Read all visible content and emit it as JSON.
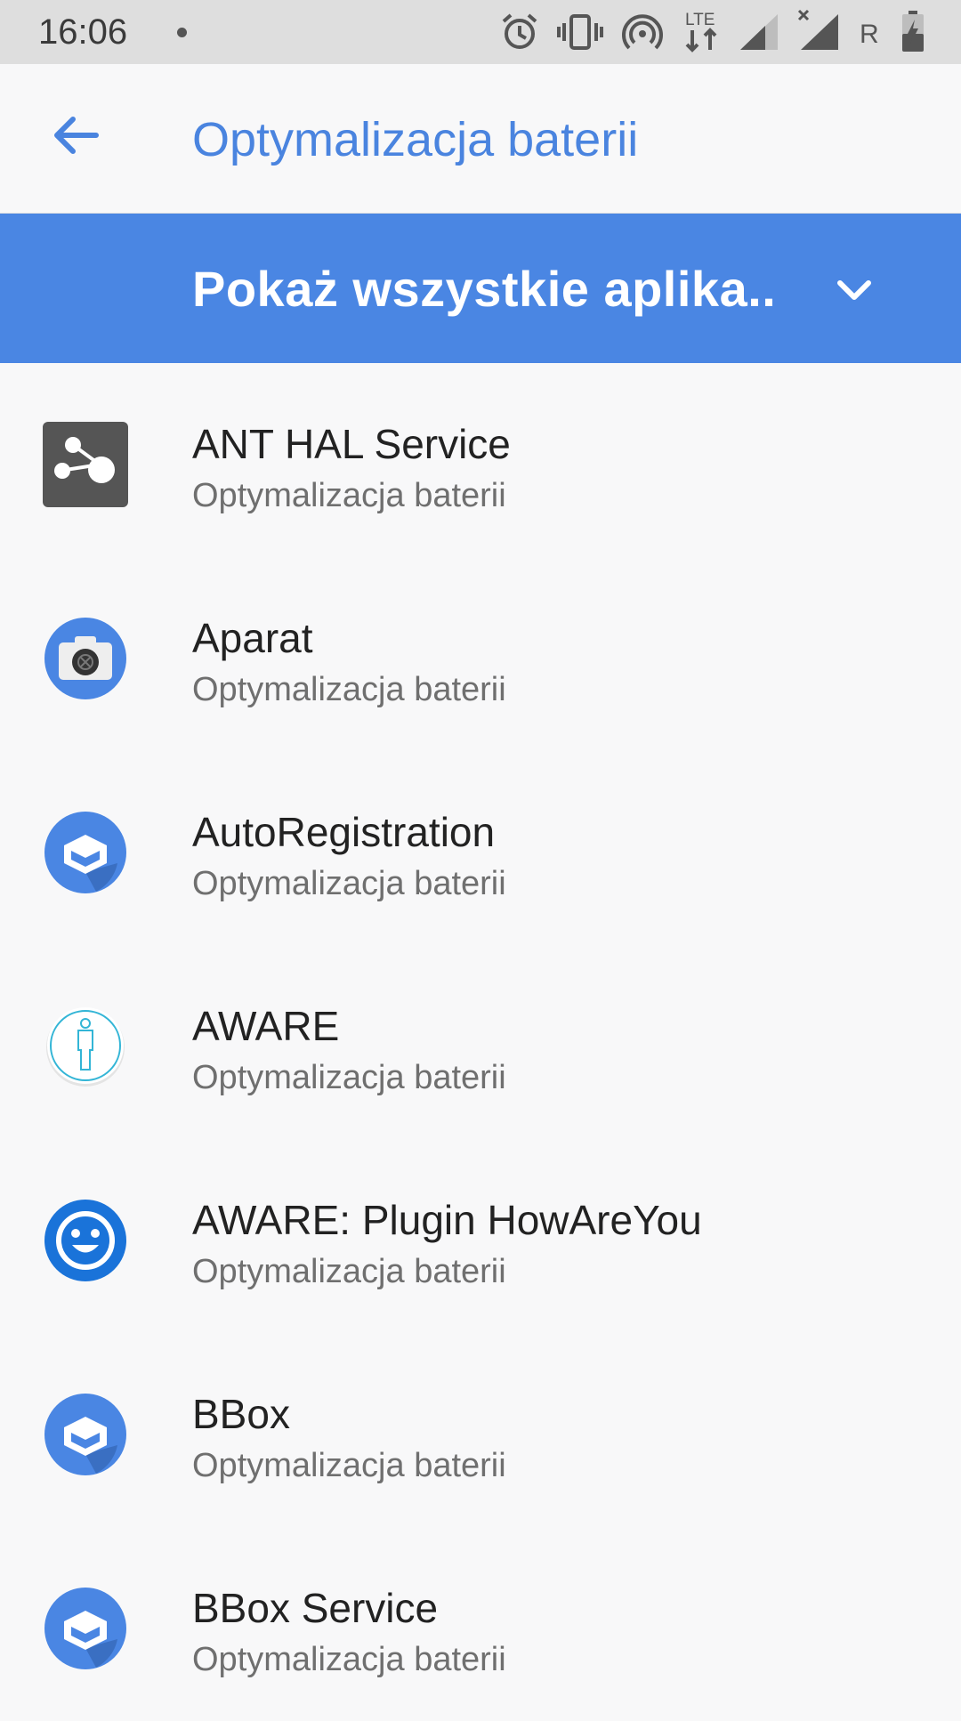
{
  "status_bar": {
    "time": "16:06",
    "roaming_label": "R",
    "network_label": "LTE",
    "icons": [
      "notification-dot-icon",
      "alarm-icon",
      "vibrate-icon",
      "hotspot-icon",
      "lte-data-icon",
      "signal-icon",
      "signal-no-data-icon",
      "battery-charging-icon"
    ]
  },
  "app_bar": {
    "title": "Optymalizacja baterii",
    "back_icon": "arrow-back-icon"
  },
  "filter": {
    "selected": "Pokaż wszystkie aplika..",
    "chevron_icon": "chevron-down-icon"
  },
  "apps": [
    {
      "name": "ANT HAL Service",
      "status": "Optymalizacja baterii",
      "icon": "ant-hal-icon"
    },
    {
      "name": "Aparat",
      "status": "Optymalizacja baterii",
      "icon": "camera-icon"
    },
    {
      "name": "AutoRegistration",
      "status": "Optymalizacja baterii",
      "icon": "android-box-icon"
    },
    {
      "name": "AWARE",
      "status": "Optymalizacja baterii",
      "icon": "aware-person-icon"
    },
    {
      "name": "AWARE: Plugin HowAreYou",
      "status": "Optymalizacja baterii",
      "icon": "smiley-icon"
    },
    {
      "name": "BBox",
      "status": "Optymalizacja baterii",
      "icon": "android-box-icon"
    },
    {
      "name": "BBox Service",
      "status": "Optymalizacja baterii",
      "icon": "android-box-icon"
    }
  ],
  "colors": {
    "accent": "#4a86e3",
    "title": "#4a84df",
    "status_bar_bg": "#dedede",
    "background": "#f8f8f9"
  }
}
